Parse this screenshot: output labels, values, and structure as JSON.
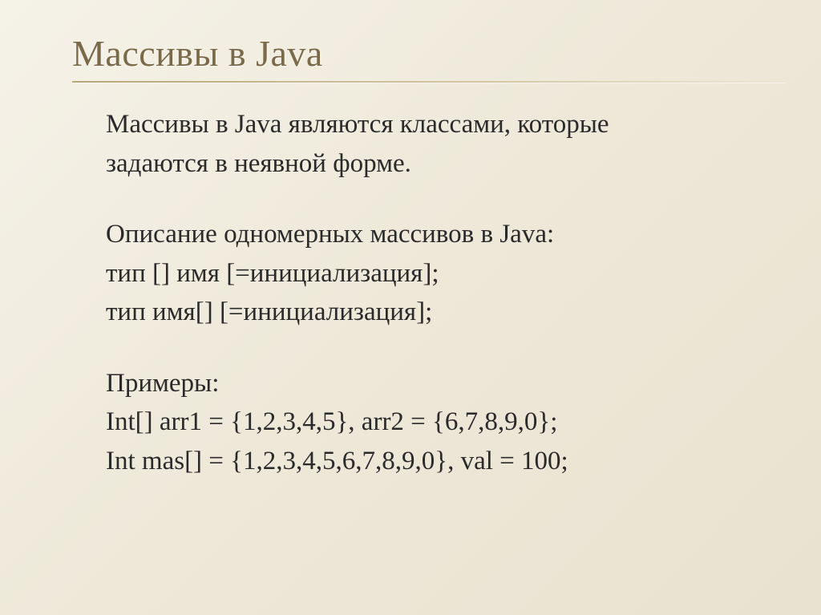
{
  "slide": {
    "title": "Массивы в Java",
    "paragraphs": {
      "intro1": "Массивы в Java являются классами, которые",
      "intro2": "задаются в неявной форме.",
      "desc1": "Описание одномерных массивов в Java:",
      "syntax1": "тип [] имя [=инициализация];",
      "syntax2": "тип имя[] [=инициализация];",
      "examples_label": "Примеры:",
      "example1": "Int[] arr1 = {1,2,3,4,5}, arr2 = {6,7,8,9,0};",
      "example2": "Int mas[] = {1,2,3,4,5,6,7,8,9,0}, val = 100;"
    }
  }
}
